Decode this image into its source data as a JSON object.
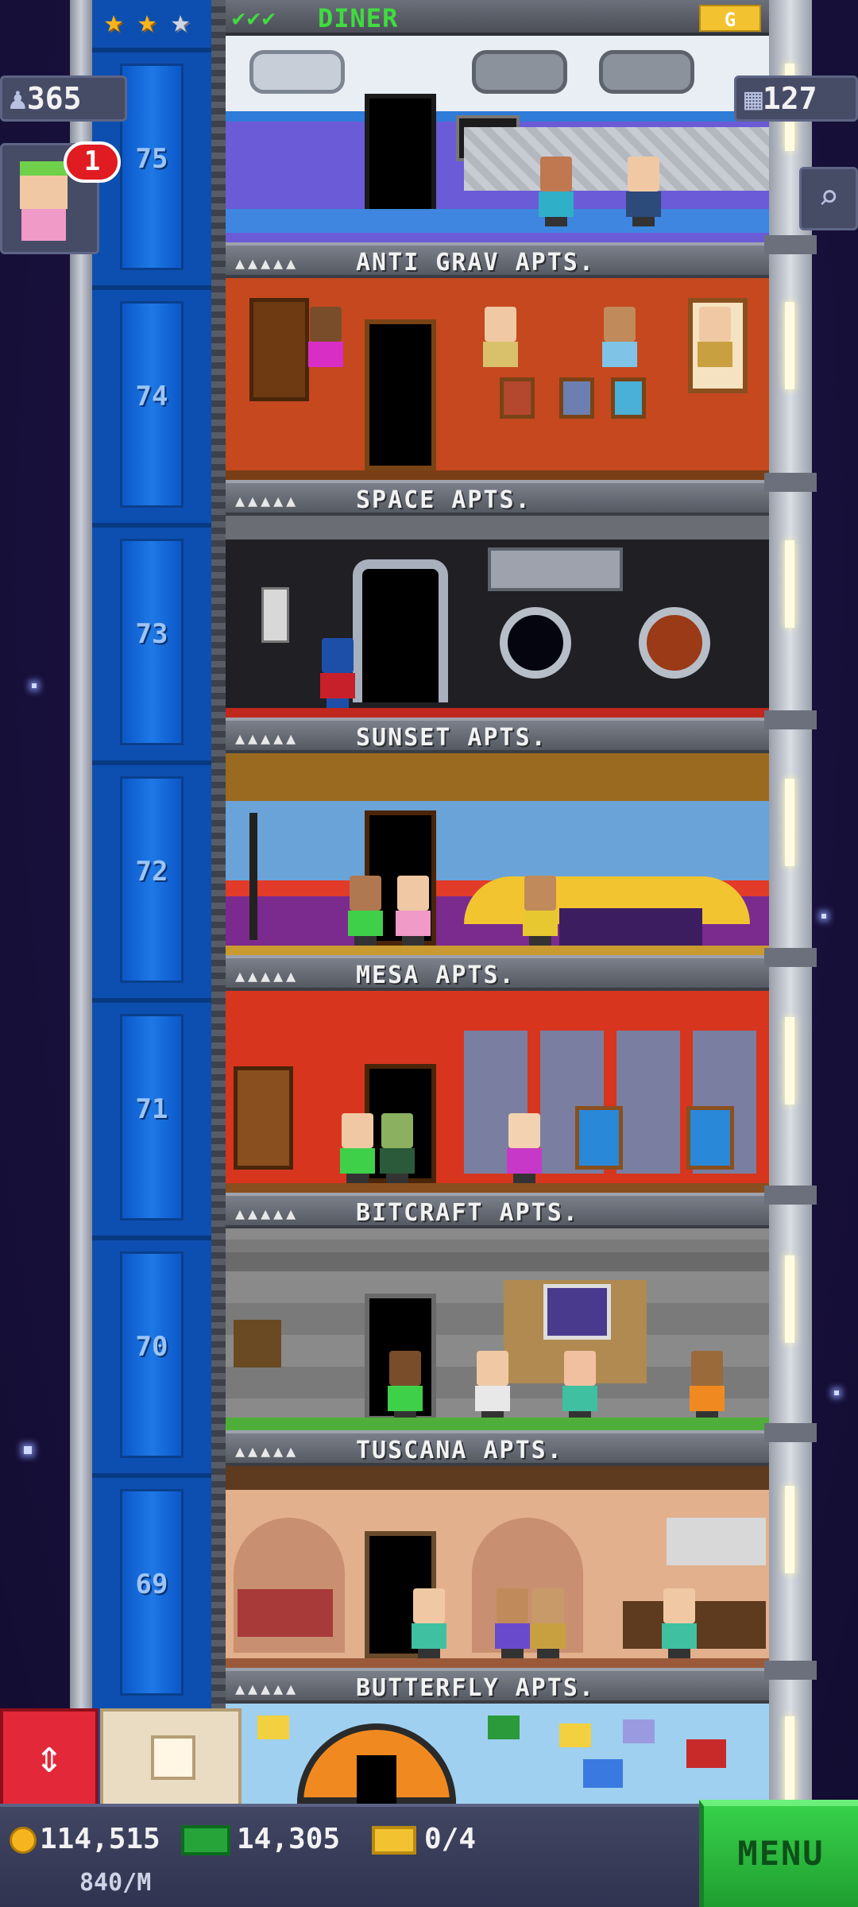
{
  "header": {
    "stars": [
      "gold-star",
      "gold-star",
      "silver-star"
    ],
    "top_floor_checks": "✔✔✔",
    "top_floor_name": "DINER",
    "top_floor_badge": "G",
    "population": "365",
    "floor_count": "127",
    "notification_count": "1"
  },
  "elevator_floors": [
    "75",
    "74",
    "73",
    "72",
    "71",
    "70",
    "69"
  ],
  "floor_labels": {
    "anti_grav": "ANTI GRAV APTS.",
    "space": "SPACE APTS.",
    "sunset": "SUNSET APTS.",
    "mesa": "MESA APTS.",
    "bitcraft": "BITCRAFT APTS.",
    "tuscana": "TUSCANA APTS.",
    "butterfly": "BUTTERFLY APTS."
  },
  "residence_dots": "▲▲▲▲▲",
  "footer": {
    "coins": "114,515",
    "bux": "14,305",
    "tickets": "0/4",
    "rate": "840/M",
    "menu_label": "MENU"
  },
  "icons": {
    "elevator": "elevator-updown-icon",
    "build": "build-box-icon",
    "search": "search-magnifier-icon",
    "coin": "coin-icon",
    "bux": "tower-bux-icon",
    "ticket": "golden-ticket-icon",
    "population": "person-icon",
    "floors": "building-icon"
  },
  "colors": {
    "elevator_blue": "#0d4fb0",
    "menu_green": "#2ebc40",
    "elevator_button_red": "#e3283a",
    "accent_green_text": "#3fdc3f"
  }
}
